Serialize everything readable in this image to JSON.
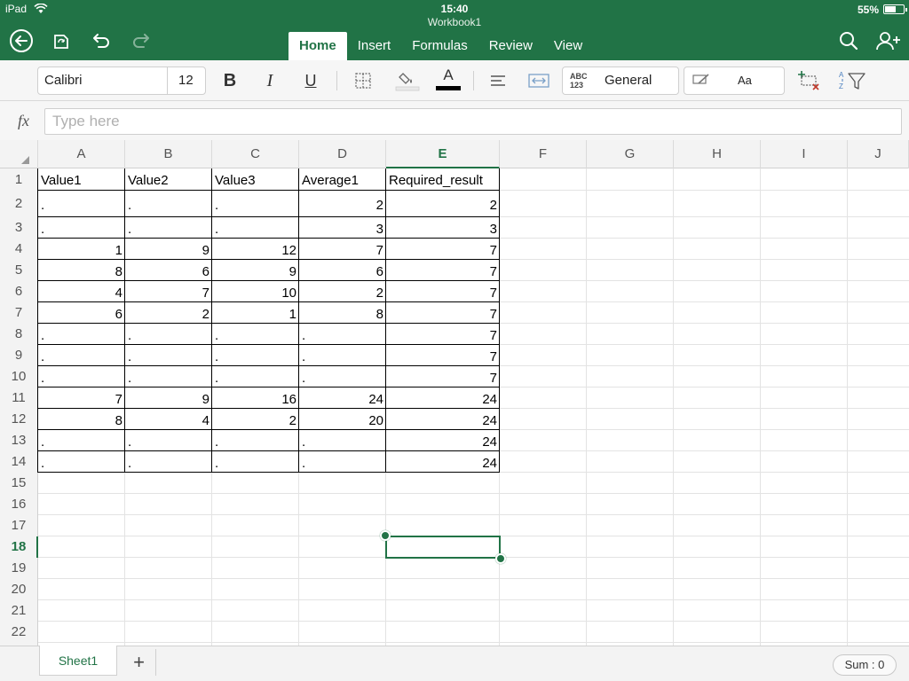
{
  "status": {
    "carrier": "iPad",
    "time": "15:40",
    "battery": "55%",
    "battery_level": 0.55
  },
  "document": {
    "title": "Workbook1"
  },
  "ribbon": {
    "tabs": [
      {
        "label": "Home",
        "active": true
      },
      {
        "label": "Insert",
        "active": false
      },
      {
        "label": "Formulas",
        "active": false
      },
      {
        "label": "Review",
        "active": false
      },
      {
        "label": "View",
        "active": false
      }
    ]
  },
  "toolbar": {
    "font_name": "Calibri",
    "font_size": "12",
    "bold": "B",
    "italic": "I",
    "underline": "U",
    "number_format_icon": "ABC 123",
    "number_format": "General",
    "cell_styles": "Aa",
    "font_color_letter": "A",
    "font_color": "#000000",
    "accent": "#217346"
  },
  "formula_bar": {
    "fx": "fx",
    "placeholder": "Type here",
    "value": ""
  },
  "sheet": {
    "columns": [
      "A",
      "B",
      "C",
      "D",
      "E",
      "F",
      "G",
      "H",
      "I",
      "J"
    ],
    "active_column": "E",
    "rows": [
      "1",
      "2",
      "3",
      "4",
      "5",
      "6",
      "7",
      "8",
      "9",
      "10",
      "11",
      "12",
      "13",
      "14",
      "15",
      "16",
      "17",
      "18",
      "19",
      "20",
      "21",
      "22"
    ],
    "active_row": "18",
    "selected_cell": "E18",
    "headers": [
      "Value1",
      "Value2",
      "Value3",
      "Average1",
      "Required_result"
    ],
    "data": [
      [
        ".",
        ".",
        ".",
        "2",
        "2"
      ],
      [
        ".",
        ".",
        ".",
        "3",
        "3"
      ],
      [
        "1",
        "9",
        "12",
        "7",
        "7"
      ],
      [
        "8",
        "6",
        "9",
        "6",
        "7"
      ],
      [
        "4",
        "7",
        "10",
        "2",
        "7"
      ],
      [
        "6",
        "2",
        "1",
        "8",
        "7"
      ],
      [
        ".",
        ".",
        ".",
        ".",
        "7"
      ],
      [
        ".",
        ".",
        ".",
        ".",
        "7"
      ],
      [
        ".",
        ".",
        ".",
        ".",
        "7"
      ],
      [
        "7",
        "9",
        "16",
        "24",
        "24"
      ],
      [
        "8",
        "4",
        "2",
        "20",
        "24"
      ],
      [
        ".",
        ".",
        ".",
        ".",
        "24"
      ],
      [
        ".",
        ".",
        ".",
        ".",
        "24"
      ]
    ]
  },
  "sheetbar": {
    "tabs": [
      "Sheet1"
    ],
    "add_label": "+",
    "sum": "Sum : 0"
  }
}
